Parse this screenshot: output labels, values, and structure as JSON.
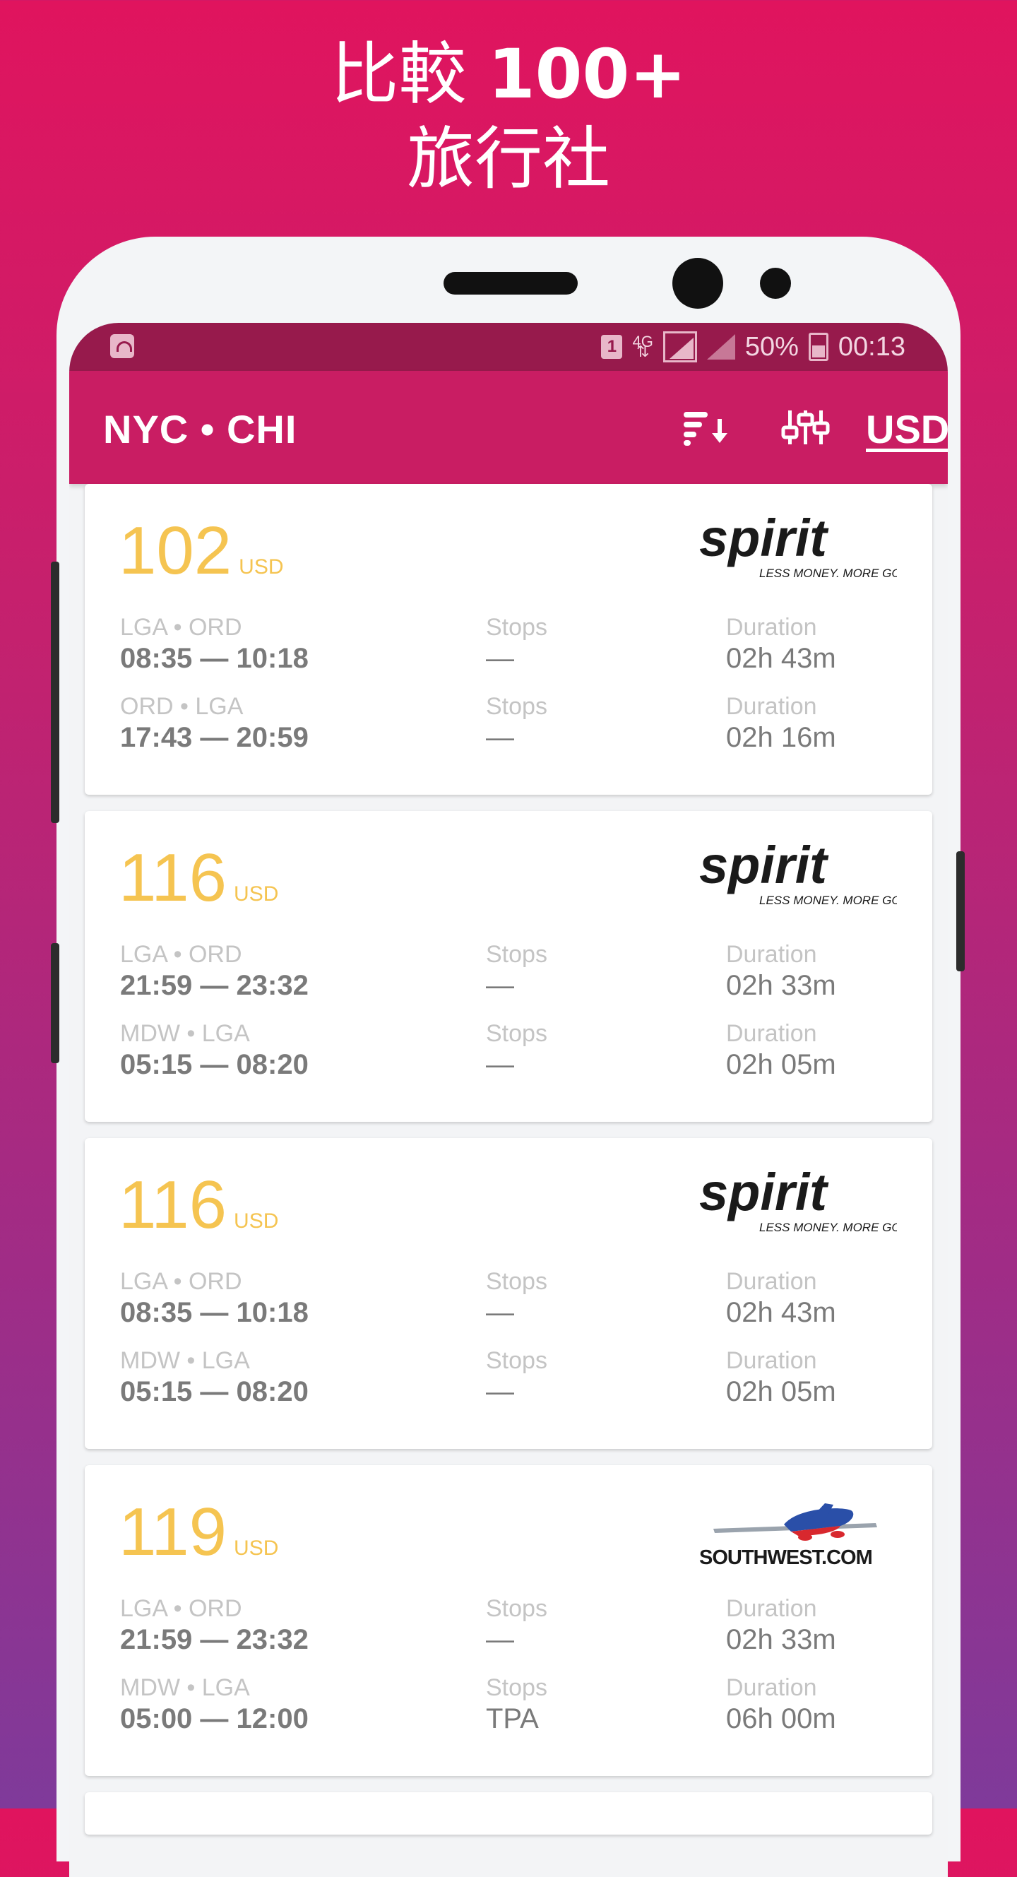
{
  "headline": {
    "line1_text": "比較",
    "line1_bold": "100+",
    "line2": "旅行社"
  },
  "status_bar": {
    "sim": "1",
    "network": "4G",
    "battery": "50%",
    "time": "00:13"
  },
  "app_bar": {
    "route": "NYC • CHI",
    "currency": "USD"
  },
  "labels": {
    "stops": "Stops",
    "duration": "Duration"
  },
  "results": [
    {
      "price": "102",
      "currency": "USD",
      "airline": "spirit",
      "airline_tagline": "LESS MONEY. MORE GO.",
      "legs": [
        {
          "route": "LGA • ORD",
          "times": "08:35 — 10:18",
          "stops": "—",
          "duration": "02h 43m"
        },
        {
          "route": "ORD • LGA",
          "times": "17:43 — 20:59",
          "stops": "—",
          "duration": "02h 16m"
        }
      ]
    },
    {
      "price": "116",
      "currency": "USD",
      "airline": "spirit",
      "airline_tagline": "LESS MONEY. MORE GO.",
      "legs": [
        {
          "route": "LGA • ORD",
          "times": "21:59 — 23:32",
          "stops": "—",
          "duration": "02h 33m"
        },
        {
          "route": "MDW • LGA",
          "times": "05:15 — 08:20",
          "stops": "—",
          "duration": "02h 05m"
        }
      ]
    },
    {
      "price": "116",
      "currency": "USD",
      "airline": "spirit",
      "airline_tagline": "LESS MONEY. MORE GO.",
      "legs": [
        {
          "route": "LGA • ORD",
          "times": "08:35 — 10:18",
          "stops": "—",
          "duration": "02h 43m"
        },
        {
          "route": "MDW • LGA",
          "times": "05:15 — 08:20",
          "stops": "—",
          "duration": "02h 05m"
        }
      ]
    },
    {
      "price": "119",
      "currency": "USD",
      "airline": "SOUTHWEST.COM",
      "airline_tagline": "",
      "legs": [
        {
          "route": "LGA • ORD",
          "times": "21:59 — 23:32",
          "stops": "—",
          "duration": "02h 33m"
        },
        {
          "route": "MDW • LGA",
          "times": "05:00 — 12:00",
          "stops": "TPA",
          "duration": "06h 00m"
        }
      ]
    }
  ],
  "colors": {
    "app_bar": "#c91d63",
    "status_bar": "#971a4c",
    "price": "#f5c451",
    "bg_top": "#e0145e",
    "bg_bottom": "#7f3a9a"
  }
}
